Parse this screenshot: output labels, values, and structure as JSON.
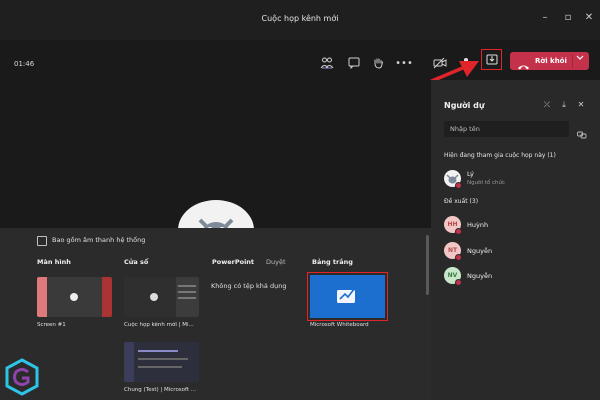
{
  "window": {
    "title": "Cuộc họp kênh mới"
  },
  "toolbar": {
    "timer": "01:46",
    "leave_label": "Rời khỏi"
  },
  "share_tray": {
    "include_audio_label": "Bao gồm âm thanh hệ thống",
    "sections": {
      "screen": "Màn hình",
      "window": "Cửa sổ",
      "powerpoint": "PowerPoint",
      "browse": "Duyệt",
      "whiteboard": "Bảng trắng"
    },
    "screens": [
      {
        "caption": "Screen #1"
      }
    ],
    "windows": [
      {
        "caption": "Cuộc họp kênh mới | Mi..."
      },
      {
        "caption": "Chung (Test) | Microsoft ..."
      }
    ],
    "powerpoint_empty": "Không có tệp khả dụng",
    "whiteboard_caption": "Microsoft Whiteboard"
  },
  "participants_panel": {
    "title": "Người dự",
    "search_placeholder": "Nhập tên",
    "in_meeting_header": "Hiện đang tham gia cuộc họp này (1)",
    "suggested_header": "Đề xuất (3)",
    "in_meeting": [
      {
        "name": "Lý",
        "role": "Người tổ chức"
      }
    ],
    "suggested": [
      {
        "initials": "HH",
        "name": "Huỳnh",
        "color": "#f4c7c7"
      },
      {
        "initials": "NT",
        "name": "Nguyễn",
        "color": "#f4c7c7"
      },
      {
        "initials": "NV",
        "name": "Nguyễn",
        "color": "#c8e6c9"
      }
    ]
  },
  "colors": {
    "accent_red": "#c4314b",
    "highlight_red": "#e1242a",
    "whiteboard_blue": "#1d6fcf"
  }
}
